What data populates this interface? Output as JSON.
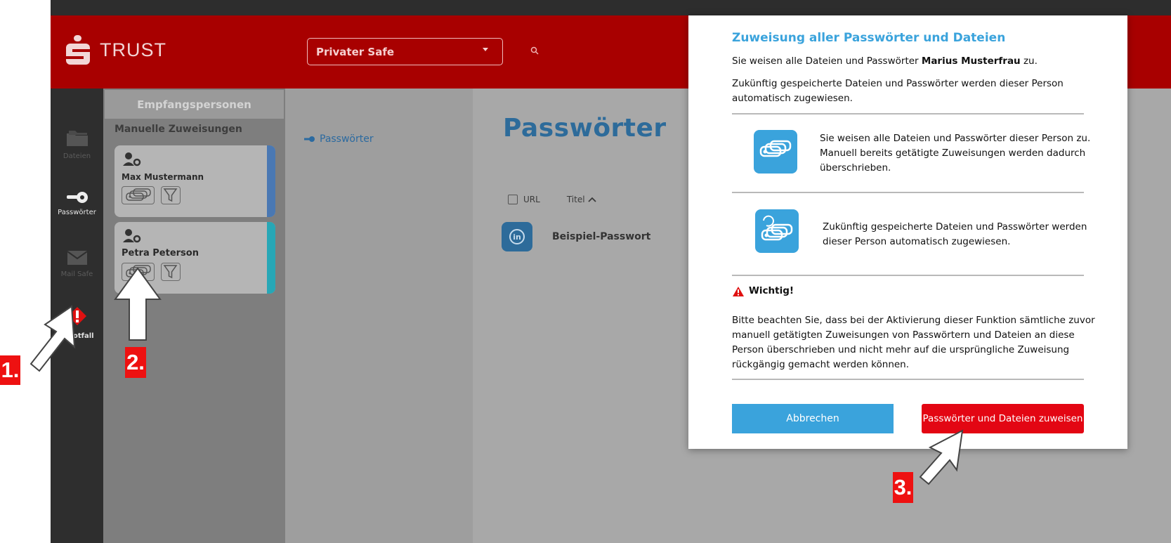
{
  "header": {
    "logo_text": "TRUST",
    "safe_select": "Privater Safe"
  },
  "nav": {
    "items": [
      {
        "label": "Dateien"
      },
      {
        "label": "Passwörter"
      },
      {
        "label": "Mail Safe"
      },
      {
        "label": "otfall"
      }
    ]
  },
  "recipients": {
    "title": "Empfangspersonen",
    "section": "Manuelle Zuweisungen",
    "people": [
      {
        "name": "Max Mustermann",
        "accent": "#4a78b3"
      },
      {
        "name": "Petra Peterson",
        "accent": "#27a7b6"
      }
    ]
  },
  "breadcrumb": {
    "label": "Passwörter"
  },
  "main": {
    "title": "Passwörter",
    "columns": {
      "url": "URL",
      "title": "Titel"
    },
    "rows": [
      {
        "icon": "linkedin-icon",
        "icon_text": "in",
        "title": "Beispiel-Passwort"
      }
    ]
  },
  "modal": {
    "title": "Zuweisung aller Passwörter und Dateien",
    "intro_before": "Sie weisen alle Dateien und Passwörter ",
    "intro_name": "Marius Musterfrau",
    "intro_after": " zu.",
    "future_line1": "Zukünftig gespeicherte Dateien und Passwörter werden dieser Person",
    "future_line2": "automatisch zugewiesen.",
    "option1": {
      "line1": "Sie weisen alle Dateien und Passwörter dieser Person zu.",
      "line2": "Manuell bereits getätigte Zuweisungen werden dadurch",
      "line3": "überschrieben."
    },
    "option2": {
      "line1": "Zukünftig gespeicherte Dateien und Passwörter werden",
      "line2": "dieser Person automatisch zugewiesen."
    },
    "warning_title": "Wichtig!",
    "warning_lines": [
      "Bitte beachten Sie, dass bei der Aktivierung dieser Funktion sämtliche zuvor",
      "manuell getätigten Zuweisungen von Passwörtern und Dateien an diese",
      "Person überschrieben und nicht mehr auf die ursprüngliche Zuweisung",
      "rückgängig gemacht werden können."
    ],
    "cancel_label": "Abbrechen",
    "confirm_label": "Passwörter und Dateien zuweisen"
  },
  "annotations": {
    "step1": "1.",
    "step2": "2.",
    "step3": "3."
  },
  "colors": {
    "brand_red": "#a80000",
    "accent_blue": "#3aa3dc",
    "confirm_red": "#e30613",
    "annotation_red": "#ee1111"
  }
}
